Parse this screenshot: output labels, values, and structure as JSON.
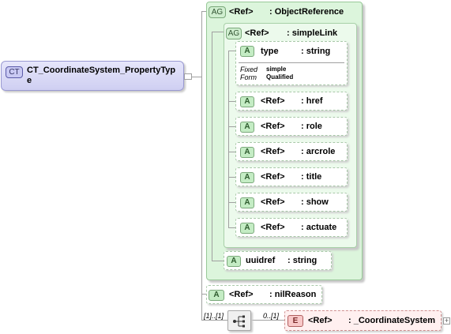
{
  "complex_type": {
    "badge": "CT",
    "name_line1": "CT_CoordinateSystem_PropertyTyp",
    "name_line2": "e"
  },
  "object_reference": {
    "badge": "AG",
    "ref": "<Ref>",
    "type": ": ObjectReference"
  },
  "simple_link": {
    "badge": "AG",
    "ref": "<Ref>",
    "type": ": simpleLink"
  },
  "type_attribute": {
    "badge": "A",
    "name": "type",
    "type": ": string",
    "fixed_label": "Fixed",
    "fixed_value": "simple",
    "form_label": "Form",
    "form_value": "Qualified"
  },
  "link_attributes": [
    {
      "badge": "A",
      "ref": "<Ref>",
      "name": ": href"
    },
    {
      "badge": "A",
      "ref": "<Ref>",
      "name": ": role"
    },
    {
      "badge": "A",
      "ref": "<Ref>",
      "name": ": arcrole"
    },
    {
      "badge": "A",
      "ref": "<Ref>",
      "name": ": title"
    },
    {
      "badge": "A",
      "ref": "<Ref>",
      "name": ": show"
    },
    {
      "badge": "A",
      "ref": "<Ref>",
      "name": ": actuate"
    }
  ],
  "uuidref": {
    "badge": "A",
    "name": "uuidref",
    "type": ": string"
  },
  "nil_reason": {
    "badge": "A",
    "ref": "<Ref>",
    "type": ": nilReason"
  },
  "sequence": {
    "cardinality": "[1]..[1]",
    "icon": "sequence-icon"
  },
  "coordinate_system": {
    "badge": "E",
    "ref": "<Ref>",
    "type": ": _CoordinateSystem",
    "cardinality": "0..[1]",
    "expand": "+"
  }
}
